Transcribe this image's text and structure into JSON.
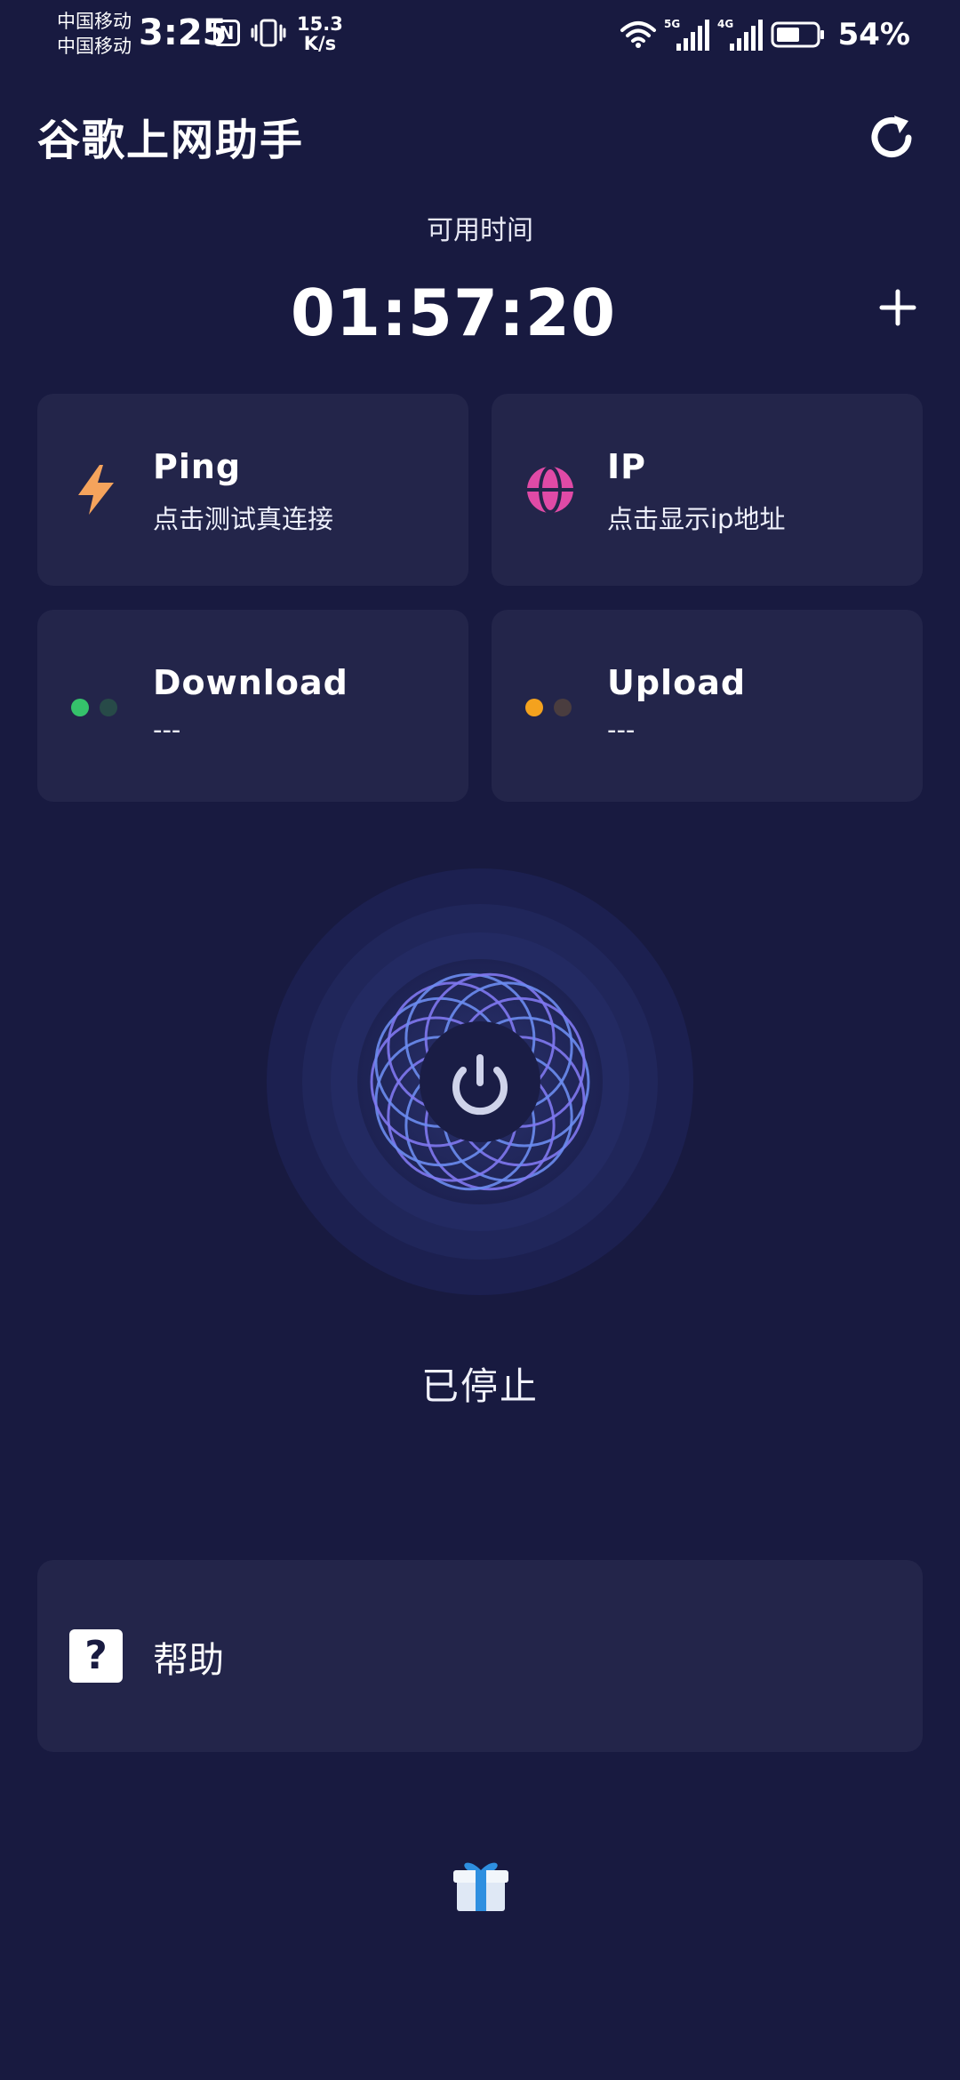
{
  "status_bar": {
    "carrier1": "中国移动",
    "carrier2": "中国移动",
    "time": "3:25",
    "nfc": "N",
    "net_speed_value": "15.3",
    "net_speed_unit": "K/s",
    "sig1_label": "5G",
    "sig2_label": "4G",
    "battery": "54%",
    "icons": [
      "nfc-icon",
      "vibrate-icon",
      "wifi-icon",
      "signal-5g-icon",
      "signal-4g-icon",
      "battery-icon"
    ]
  },
  "header": {
    "title": "谷歌上网助手",
    "refresh_icon": "refresh-icon"
  },
  "timer": {
    "label": "可用时间",
    "value": "01:57:20",
    "add_icon": "plus-icon"
  },
  "cards": {
    "ping": {
      "title": "Ping",
      "subtitle": "点击测试真连接",
      "icon": "lightning-icon",
      "color": "#f5a35c"
    },
    "ip": {
      "title": "IP",
      "subtitle": "点击显示ip地址",
      "icon": "globe-icon",
      "color": "#e04aa6"
    },
    "download": {
      "title": "Download",
      "value": "---",
      "dot_active": "#35c26b",
      "dot_inactive": "#274a48"
    },
    "upload": {
      "title": "Upload",
      "value": "---",
      "dot_active": "#f4a21e",
      "dot_inactive": "#4a3d3f"
    }
  },
  "power": {
    "icon": "power-icon",
    "status": "已停止",
    "ring_color": "#6b8cf0"
  },
  "help": {
    "label": "帮助",
    "icon": "question-icon"
  },
  "footer": {
    "icon": "gift-icon"
  },
  "colors": {
    "background": "#181a40",
    "card": "#23254a"
  }
}
